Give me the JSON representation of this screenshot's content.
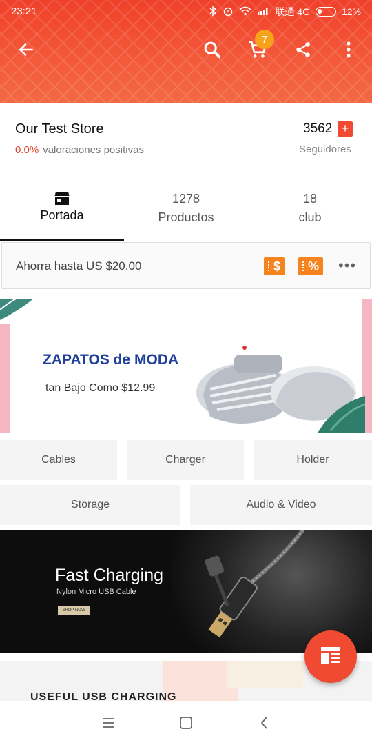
{
  "status_bar": {
    "time": "23:21",
    "carrier": "联通 4G",
    "battery": "12%"
  },
  "header": {
    "cart_count": "7"
  },
  "store": {
    "name": "Our Test Store",
    "rating_pct": "0.0%",
    "rating_label": "valoraciones positivas",
    "followers": "3562",
    "followers_label": "Seguidores",
    "follow_button": "+"
  },
  "tabs": [
    {
      "num": "",
      "label": "Portada",
      "active": true
    },
    {
      "num": "1278",
      "label": "Productos",
      "active": false
    },
    {
      "num": "18",
      "label": "club",
      "active": false
    }
  ],
  "coupon": {
    "text": "Ahorra hasta US $20.00",
    "tag1": "$",
    "tag2": "%",
    "more": "•••"
  },
  "banner1": {
    "title": "ZAPATOS de MODA",
    "subtitle": "tan Bajo Como $12.99"
  },
  "categories": [
    "Cables",
    "Charger",
    "Holder",
    "Storage",
    "Audio & Video"
  ],
  "banner2": {
    "title": "Fast Charging",
    "subtitle": "Nylon Micro USB Cable",
    "cta": "SHOP NOW"
  },
  "banner3": {
    "title": "USEFUL USB CHARGING"
  },
  "colors": {
    "accent": "#f04a32",
    "badge": "#f7a21b",
    "coupon_tag": "#f5841f",
    "banner_title": "#1f3f9a"
  },
  "icons": {
    "back": "arrow-left-icon",
    "search": "search-icon",
    "cart": "cart-icon",
    "share": "share-icon",
    "more": "more-vertical-icon",
    "store": "store-icon",
    "fab": "store-menu-icon"
  }
}
